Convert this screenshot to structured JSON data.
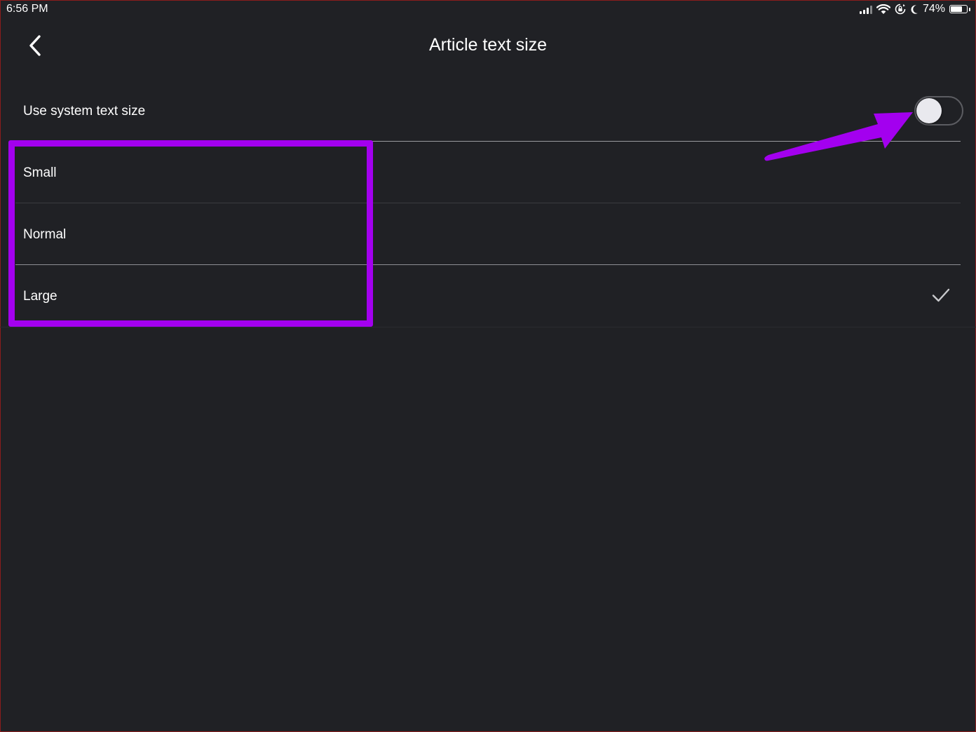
{
  "status_bar": {
    "time": "6:56 PM",
    "battery_percent": "74%",
    "battery_level": 0.74,
    "icons": [
      "signal-icon",
      "wifi-icon",
      "rotation-lock-icon",
      "moon-icon",
      "battery-icon"
    ]
  },
  "nav": {
    "back_icon": "chevron-left-icon",
    "title": "Article text size"
  },
  "system_text": {
    "label": "Use system text size",
    "toggle_on": false
  },
  "size_options": {
    "items": [
      {
        "label": "Small",
        "selected": false
      },
      {
        "label": "Normal",
        "selected": false
      },
      {
        "label": "Large",
        "selected": true
      }
    ],
    "selected_icon": "checkmark-icon"
  },
  "annotations": {
    "highlight_color": "#a300ef",
    "arrow_color": "#a300ef"
  },
  "colors": {
    "background": "#202125",
    "text": "#ffffff",
    "toggle_knob": "#e9e9ee"
  }
}
